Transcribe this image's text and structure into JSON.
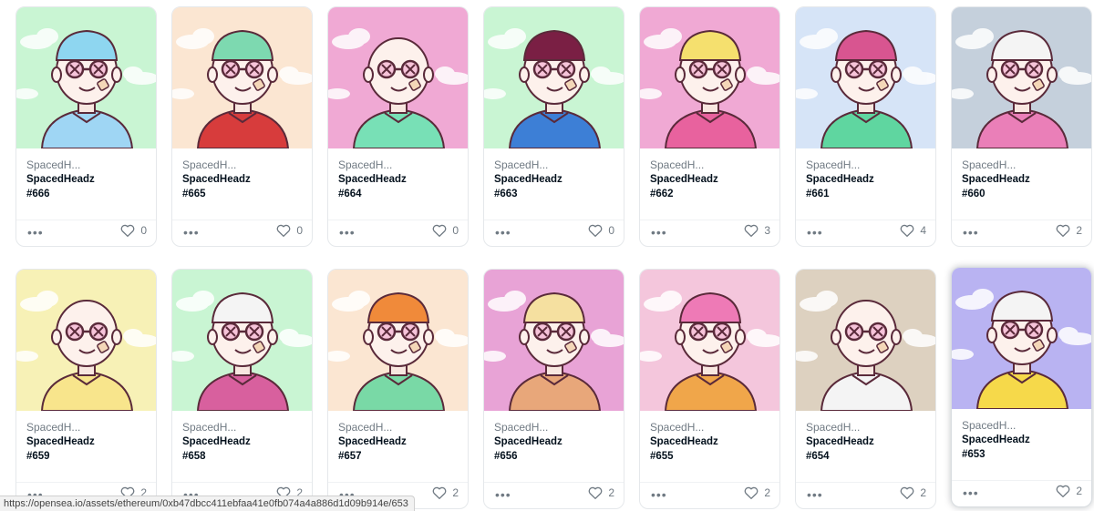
{
  "items": [
    {
      "collection_short": "SpacedH...",
      "collection": "SpacedHeadz",
      "token": "#666",
      "favorites": "0",
      "bg": "#c9f5d3",
      "shirt": "#9fd6f4",
      "hat": "#8ed6f0",
      "hovered": false
    },
    {
      "collection_short": "SpacedH...",
      "collection": "SpacedHeadz",
      "token": "#665",
      "favorites": "0",
      "bg": "#fbe6d2",
      "shirt": "#d73c3c",
      "hat": "#7dd9b0",
      "hovered": false
    },
    {
      "collection_short": "SpacedH...",
      "collection": "SpacedHeadz",
      "token": "#664",
      "favorites": "0",
      "bg": "#f0a9d4",
      "shirt": "#78e0b6",
      "hat": "",
      "hovered": false
    },
    {
      "collection_short": "SpacedH...",
      "collection": "SpacedHeadz",
      "token": "#663",
      "favorites": "0",
      "bg": "#c9f5d3",
      "shirt": "#3d7fd6",
      "hat": "#7a1f44",
      "hovered": false
    },
    {
      "collection_short": "SpacedH...",
      "collection": "SpacedHeadz",
      "token": "#662",
      "favorites": "3",
      "bg": "#f0a9d4",
      "shirt": "#e8629e",
      "hat": "#f5e06e",
      "hovered": false
    },
    {
      "collection_short": "SpacedH...",
      "collection": "SpacedHeadz",
      "token": "#661",
      "favorites": "4",
      "bg": "#d6e4f7",
      "shirt": "#5fd6a0",
      "hat": "#d85590",
      "hovered": false
    },
    {
      "collection_short": "SpacedH...",
      "collection": "SpacedHeadz",
      "token": "#660",
      "favorites": "2",
      "bg": "#c5d0dc",
      "shirt": "#ea7fb8",
      "hat": "#f4f4f4",
      "hovered": false
    },
    {
      "collection_short": "SpacedH...",
      "collection": "SpacedHeadz",
      "token": "#659",
      "favorites": "2",
      "bg": "#f7f1b6",
      "shirt": "#f8e58c",
      "hat": "",
      "hovered": false
    },
    {
      "collection_short": "SpacedH...",
      "collection": "SpacedHeadz",
      "token": "#658",
      "favorites": "2",
      "bg": "#c9f5d3",
      "shirt": "#d8609e",
      "hat": "#f4f4f4",
      "hovered": false
    },
    {
      "collection_short": "SpacedH...",
      "collection": "SpacedHeadz",
      "token": "#657",
      "favorites": "2",
      "bg": "#fbe6d2",
      "shirt": "#79d9a6",
      "hat": "#f08a3a",
      "hovered": false
    },
    {
      "collection_short": "SpacedH...",
      "collection": "SpacedHeadz",
      "token": "#656",
      "favorites": "2",
      "bg": "#e8a3d6",
      "shirt": "#e8a77a",
      "hat": "#f5e0a0",
      "hovered": false
    },
    {
      "collection_short": "SpacedH...",
      "collection": "SpacedHeadz",
      "token": "#655",
      "favorites": "2",
      "bg": "#f4c6dc",
      "shirt": "#f0a64a",
      "hat": "#ee7ab6",
      "hovered": false
    },
    {
      "collection_short": "SpacedH...",
      "collection": "SpacedHeadz",
      "token": "#654",
      "favorites": "2",
      "bg": "#ddd1c0",
      "shirt": "#f4f4f4",
      "hat": "",
      "hovered": false
    },
    {
      "collection_short": "SpacedH...",
      "collection": "SpacedHeadz",
      "token": "#653",
      "favorites": "2",
      "bg": "#b9b3f2",
      "shirt": "#f6d94a",
      "hat": "#f4f4f4",
      "hovered": true
    }
  ],
  "more_icon": "•••",
  "heart_icon": "heart-outline-icon",
  "status_bar": {
    "url": "https://opensea.io/assets/ethereum/0xb47dbcc411ebfaa41e0fb074a4a886d1d09b914e/653"
  }
}
